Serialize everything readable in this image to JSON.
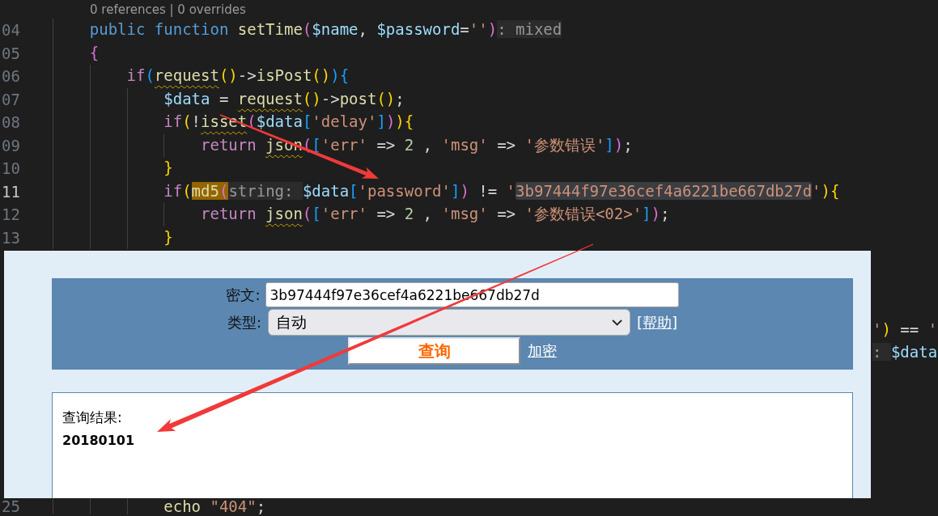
{
  "editor": {
    "code_lens": "0 references | 0 overrides",
    "lines": [
      {
        "number": "04",
        "current": false,
        "tokens": [
          {
            "kind": "keyword",
            "text": "public function "
          },
          {
            "kind": "function",
            "text": "setTime"
          },
          {
            "kind": "bracket_orchid",
            "text": "("
          },
          {
            "kind": "variable",
            "text": "$name"
          },
          {
            "kind": "plain",
            "text": ", "
          },
          {
            "kind": "variable",
            "text": "$password"
          },
          {
            "kind": "plain",
            "text": "="
          },
          {
            "kind": "string",
            "text": "''"
          },
          {
            "kind": "bracket_orchid",
            "text": ")"
          },
          {
            "kind": "hint",
            "text": ": mixed"
          }
        ]
      },
      {
        "number": "05",
        "current": false,
        "tokens": [
          {
            "kind": "bracket_orchid",
            "text": "{"
          }
        ],
        "children": [
          {
            "number": "06",
            "current": false,
            "tokens": [
              {
                "kind": "control",
                "text": "if"
              },
              {
                "kind": "bracket_blue",
                "text": "("
              },
              {
                "kind": "function_flagged",
                "text": "request"
              },
              {
                "kind": "bracket_gold",
                "text": "()"
              },
              {
                "kind": "plain",
                "text": "->"
              },
              {
                "kind": "function",
                "text": "isPost"
              },
              {
                "kind": "bracket_gold",
                "text": "()"
              },
              {
                "kind": "bracket_blue",
                "text": "){"
              }
            ],
            "children": [
              {
                "number": "07",
                "current": false,
                "tokens": [
                  {
                    "kind": "variable",
                    "text": "$data"
                  },
                  {
                    "kind": "plain",
                    "text": " = "
                  },
                  {
                    "kind": "function_flagged",
                    "text": "request"
                  },
                  {
                    "kind": "bracket_gold",
                    "text": "()"
                  },
                  {
                    "kind": "plain",
                    "text": "->"
                  },
                  {
                    "kind": "function",
                    "text": "post"
                  },
                  {
                    "kind": "bracket_gold",
                    "text": "()"
                  },
                  {
                    "kind": "plain",
                    "text": ";"
                  }
                ]
              },
              {
                "number": "08",
                "current": false,
                "tokens": [
                  {
                    "kind": "control",
                    "text": "if"
                  },
                  {
                    "kind": "bracket_gold",
                    "text": "("
                  },
                  {
                    "kind": "plain",
                    "text": "!"
                  },
                  {
                    "kind": "function_flagged",
                    "text": "isset"
                  },
                  {
                    "kind": "bracket_orchid",
                    "text": "("
                  },
                  {
                    "kind": "variable",
                    "text": "$data"
                  },
                  {
                    "kind": "bracket_blue",
                    "text": "["
                  },
                  {
                    "kind": "string",
                    "text": "'delay'"
                  },
                  {
                    "kind": "bracket_blue",
                    "text": "]"
                  },
                  {
                    "kind": "bracket_orchid",
                    "text": ")"
                  },
                  {
                    "kind": "bracket_gold",
                    "text": "){"
                  }
                ],
                "children": [
                  {
                    "number": "09",
                    "current": false,
                    "tokens": [
                      {
                        "kind": "control",
                        "text": "return "
                      },
                      {
                        "kind": "function_flagged",
                        "text": "json"
                      },
                      {
                        "kind": "bracket_orchid",
                        "text": "("
                      },
                      {
                        "kind": "bracket_blue",
                        "text": "["
                      },
                      {
                        "kind": "string",
                        "text": "'err'"
                      },
                      {
                        "kind": "plain",
                        "text": " => "
                      },
                      {
                        "kind": "number",
                        "text": "2"
                      },
                      {
                        "kind": "plain",
                        "text": " , "
                      },
                      {
                        "kind": "string",
                        "text": "'msg'"
                      },
                      {
                        "kind": "plain",
                        "text": " => "
                      },
                      {
                        "kind": "string",
                        "text": "'参数错误'"
                      },
                      {
                        "kind": "bracket_blue",
                        "text": "]"
                      },
                      {
                        "kind": "bracket_orchid",
                        "text": ")"
                      },
                      {
                        "kind": "plain",
                        "text": ";"
                      }
                    ]
                  }
                ]
              },
              {
                "number": "10",
                "current": false,
                "tokens": [
                  {
                    "kind": "bracket_gold",
                    "text": "}"
                  }
                ]
              },
              {
                "number": "11",
                "current": true,
                "tokens": [
                  {
                    "kind": "control",
                    "text": "if"
                  },
                  {
                    "kind": "bracket_gold",
                    "text": "("
                  },
                  {
                    "kind": "function_current",
                    "text": "md5"
                  },
                  {
                    "kind": "bracket_current",
                    "text": "("
                  },
                  {
                    "kind": "hint",
                    "text": "string: "
                  },
                  {
                    "kind": "variable",
                    "text": "$data"
                  },
                  {
                    "kind": "bracket_blue",
                    "text": "["
                  },
                  {
                    "kind": "string",
                    "text": "'password'"
                  },
                  {
                    "kind": "bracket_blue",
                    "text": "]"
                  },
                  {
                    "kind": "bracket_orchid",
                    "text": ")"
                  },
                  {
                    "kind": "plain",
                    "text": " != "
                  },
                  {
                    "kind": "string",
                    "text": "'"
                  },
                  {
                    "kind": "string_match",
                    "text": "3b97444f97e36cef4a6221be667db27d"
                  },
                  {
                    "kind": "string",
                    "text": "'"
                  },
                  {
                    "kind": "bracket_gold",
                    "text": "){"
                  }
                ],
                "children": [
                  {
                    "number": "12",
                    "current": false,
                    "tokens": [
                      {
                        "kind": "control",
                        "text": "return "
                      },
                      {
                        "kind": "function_flagged",
                        "text": "json"
                      },
                      {
                        "kind": "bracket_orchid",
                        "text": "("
                      },
                      {
                        "kind": "bracket_blue",
                        "text": "["
                      },
                      {
                        "kind": "string",
                        "text": "'err'"
                      },
                      {
                        "kind": "plain",
                        "text": " => "
                      },
                      {
                        "kind": "number",
                        "text": "2"
                      },
                      {
                        "kind": "plain",
                        "text": " , "
                      },
                      {
                        "kind": "string",
                        "text": "'msg'"
                      },
                      {
                        "kind": "plain",
                        "text": " => "
                      },
                      {
                        "kind": "string",
                        "text": "'参数错误<02>'"
                      },
                      {
                        "kind": "bracket_blue",
                        "text": "]"
                      },
                      {
                        "kind": "bracket_orchid",
                        "text": ")"
                      },
                      {
                        "kind": "plain",
                        "text": ";"
                      }
                    ]
                  }
                ]
              },
              {
                "number": "13",
                "current": false,
                "tokens": [
                  {
                    "kind": "bracket_gold",
                    "text": "}"
                  }
                ]
              }
            ]
          }
        ]
      }
    ],
    "side_fragments": [
      {
        "tokens": [
          {
            "kind": "string",
            "text": "'"
          },
          {
            "kind": "bracket_gold",
            "text": ")"
          },
          {
            "kind": "plain",
            "text": " == "
          },
          {
            "kind": "string",
            "text": "'"
          }
        ]
      },
      {
        "tokens": [
          {
            "kind": "hint",
            "text": ": "
          },
          {
            "kind": "variable",
            "text": "$data"
          }
        ]
      }
    ],
    "bottom_line": {
      "number": "25",
      "current": false,
      "tokens": [
        {
          "kind": "function",
          "text": "echo "
        },
        {
          "kind": "string",
          "text": "\"404\""
        },
        {
          "kind": "plain",
          "text": ";"
        }
      ]
    }
  },
  "overlay": {
    "ciphertext": {
      "label": "密文:",
      "value": "3b97444f97e36cef4a6221be667db27d"
    },
    "type": {
      "label": "类型:",
      "value": "自动"
    },
    "help_link": "[帮助]",
    "query_button": "查询",
    "encrypt_link": "加密",
    "result": {
      "heading": "查询结果:",
      "value": "20180101"
    }
  }
}
